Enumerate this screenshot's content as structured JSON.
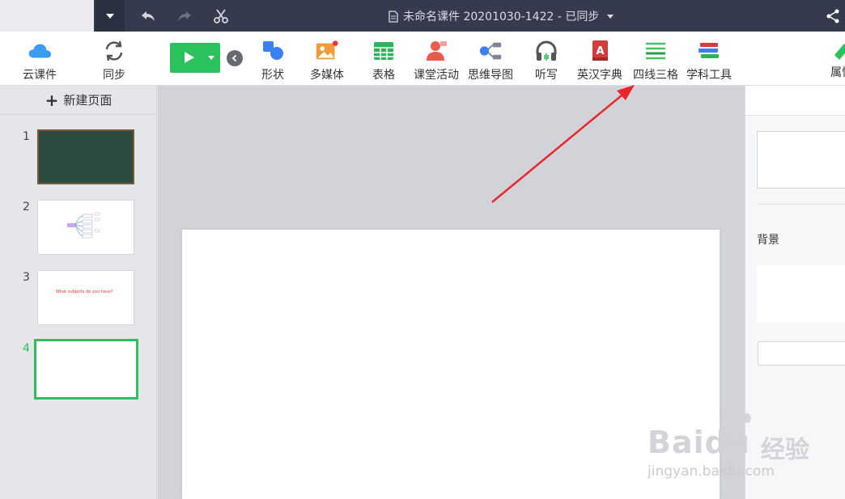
{
  "window": {
    "doc_title": "未命名课件 20201030-1422 - 已同步"
  },
  "toolbar": {
    "cloud_label": "云课件",
    "sync_label": "同步",
    "tools": [
      {
        "label": "形状",
        "icon": "shapes-icon"
      },
      {
        "label": "多媒体",
        "icon": "multimedia-icon"
      },
      {
        "label": "表格",
        "icon": "table-icon"
      },
      {
        "label": "课堂活动",
        "icon": "class-activity-icon"
      },
      {
        "label": "思维导图",
        "icon": "mindmap-icon"
      },
      {
        "label": "听写",
        "icon": "dictation-icon"
      },
      {
        "label": "英汉字典",
        "icon": "dictionary-icon"
      },
      {
        "label": "四线三格",
        "icon": "four-line-grid-icon"
      },
      {
        "label": "学科工具",
        "icon": "subject-tools-icon"
      }
    ],
    "properties_label": "属性"
  },
  "left_panel": {
    "new_page_label": "新建页面",
    "slides": [
      {
        "number": "1",
        "type": "blackboard"
      },
      {
        "number": "2",
        "type": "mindmap"
      },
      {
        "number": "3",
        "type": "text",
        "text": "What subjects do you have?"
      },
      {
        "number": "4",
        "type": "blank",
        "selected": true
      }
    ]
  },
  "right_panel": {
    "background_label": "背景"
  },
  "watermark": {
    "brand": "Baidu",
    "brand_cn": "经验",
    "url": "jingyan.baidu.com"
  },
  "colors": {
    "accent_green": "#2bc15d",
    "titlebar": "#353b4c",
    "arrow_red": "#e8262b"
  }
}
